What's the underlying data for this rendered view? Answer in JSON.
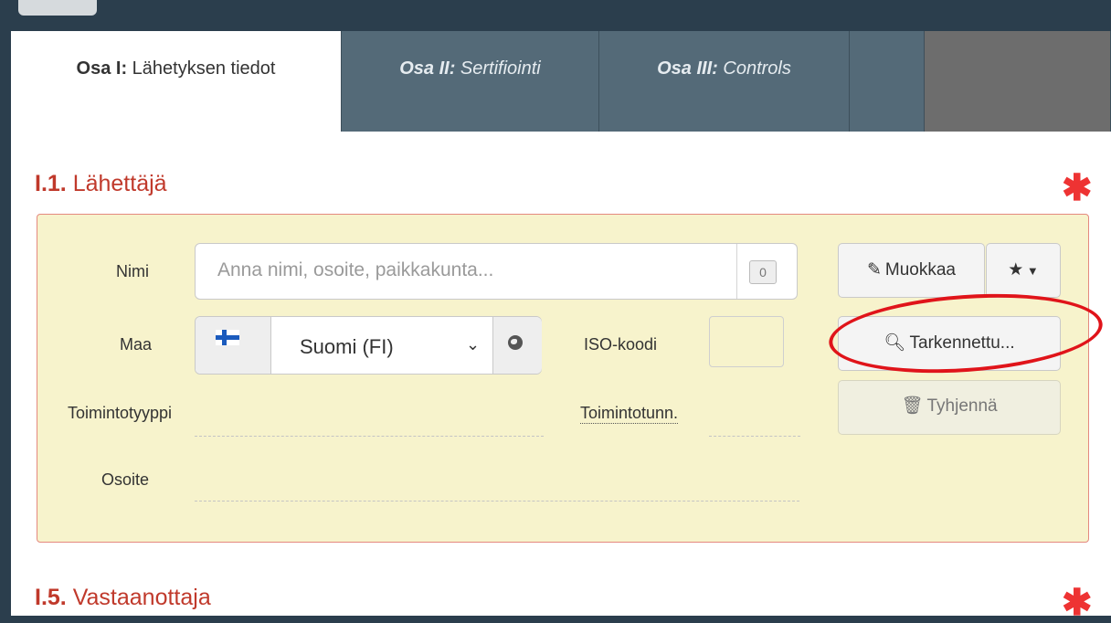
{
  "tabs": [
    {
      "bold": "Osa I:",
      "rest": " Lähetyksen tiedot"
    },
    {
      "bold": "Osa II:",
      "rest": " Sertifiointi"
    },
    {
      "bold": "Osa III:",
      "rest": " Controls"
    }
  ],
  "section1": {
    "num": "I.1.",
    "title": " Lähettäjä"
  },
  "section2": {
    "num": "I.5.",
    "title": " Vastaanottaja"
  },
  "required_star": "✱",
  "fields": {
    "name_label": "Nimi",
    "name_placeholder": "Anna nimi, osoite, paikkakunta...",
    "name_counter": "0",
    "country_label": "Maa",
    "country_value": "Suomi (FI)",
    "iso_label": "ISO-koodi",
    "activity_type_label": "Toimintotyyppi",
    "activity_id_label": "Toimintotunn.",
    "address_label": "Osoite"
  },
  "buttons": {
    "edit": "Muokkaa",
    "advanced": "Tarkennettu...",
    "clear": "Tyhjennä"
  },
  "icons": {
    "edit": "edit-icon",
    "star": "star-icon",
    "caret": "caret-down-icon",
    "search": "search-icon",
    "trash": "trash-icon",
    "globe": "globe-icon",
    "flag": "flag-fi-icon"
  },
  "colors": {
    "accent_red": "#c0392b",
    "panel_bg": "#f7f3cc",
    "tab_bg": "#546a78",
    "annotation": "#e0141a"
  }
}
